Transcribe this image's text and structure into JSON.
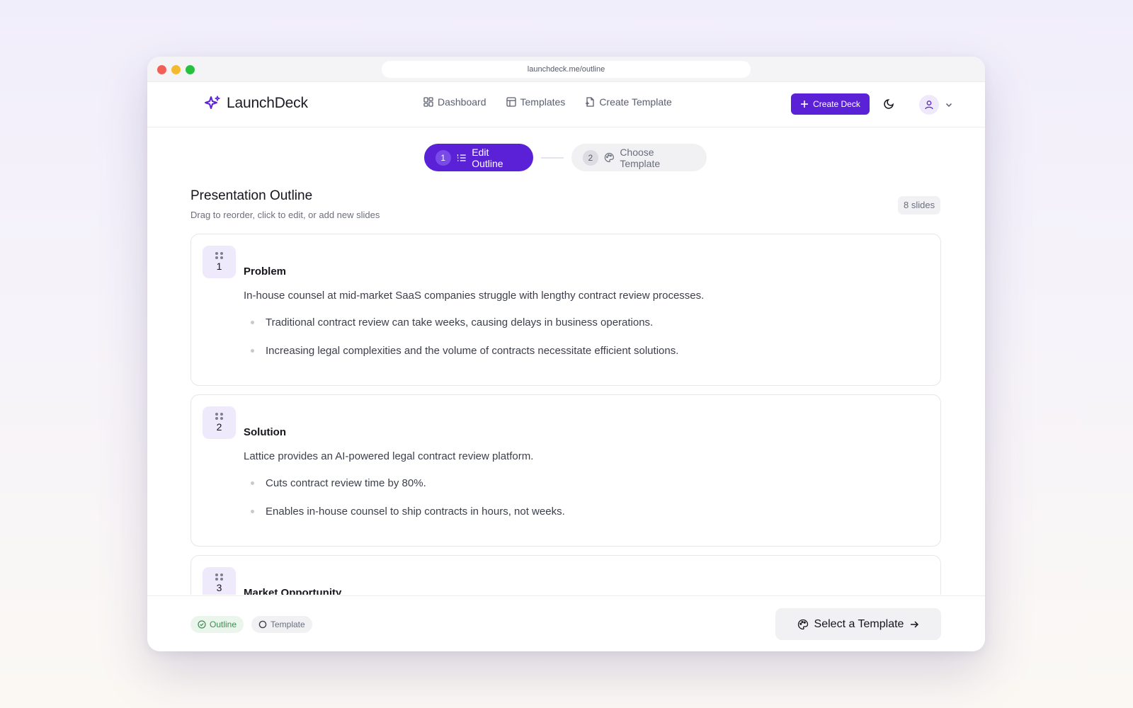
{
  "browser": {
    "url": "launchdeck.me/outline"
  },
  "brand": {
    "name": "LaunchDeck",
    "accent": "#5b21d6"
  },
  "nav": {
    "links": [
      {
        "label": "Dashboard",
        "icon": "dashboard-grid-icon"
      },
      {
        "label": "Templates",
        "icon": "layout-icon"
      },
      {
        "label": "Create Template",
        "icon": "file-plus-icon"
      }
    ],
    "create_label": "Create Deck"
  },
  "stepper": {
    "steps": [
      {
        "num": "1",
        "label": "Edit Outline",
        "active": true
      },
      {
        "num": "2",
        "label": "Choose Template",
        "active": false
      }
    ]
  },
  "outline": {
    "title": "Presentation Outline",
    "subtitle": "Drag to reorder, click to edit, or add new slides",
    "count_label": "8 slides",
    "slides": [
      {
        "num": "1",
        "title": "Problem",
        "desc": "In-house counsel at mid-market SaaS companies struggle with lengthy contract review processes.",
        "bullets": [
          "Traditional contract review can take weeks, causing delays in business operations.",
          "Increasing legal complexities and the volume of contracts necessitate efficient solutions."
        ]
      },
      {
        "num": "2",
        "title": "Solution",
        "desc": "Lattice provides an AI-powered legal contract review platform.",
        "bullets": [
          "Cuts contract review time by 80%.",
          "Enables in-house counsel to ship contracts in hours, not weeks."
        ]
      },
      {
        "num": "3",
        "title": "Market Opportunity"
      }
    ]
  },
  "footer": {
    "status_outline": "Outline",
    "status_template": "Template",
    "select_label": "Select a Template"
  }
}
